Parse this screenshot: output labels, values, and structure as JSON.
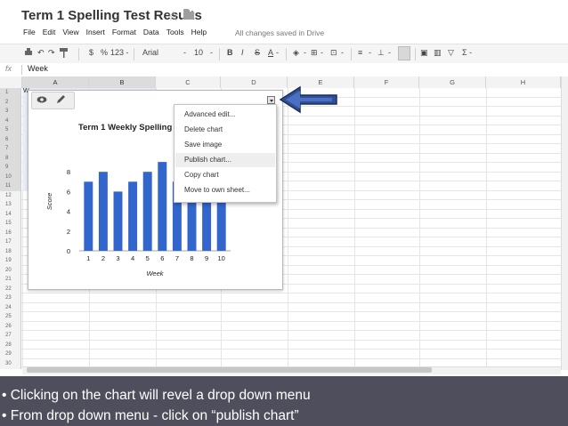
{
  "title_bar": {
    "title": "Term 1 Spelling Test Results",
    "star_icon": "star-icon",
    "folder_icon": "folder-icon"
  },
  "menu": {
    "items": [
      "File",
      "Edit",
      "View",
      "Insert",
      "Format",
      "Data",
      "Tools",
      "Help"
    ],
    "status": "All changes saved in Drive"
  },
  "toolbar": {
    "currency": "$",
    "percent": "%",
    "number_format": "123 -",
    "font": "Arial",
    "font_size": "10",
    "bold": "B",
    "italic": "I",
    "strike": "S",
    "text_color": "A",
    "function": "Σ -"
  },
  "formula_bar": {
    "fx": "fx",
    "value": "Week"
  },
  "sheet": {
    "columns": [
      "A",
      "B",
      "C",
      "D",
      "E",
      "F",
      "G",
      "H"
    ],
    "selected_columns": [
      "A",
      "B"
    ],
    "rows": [
      "1",
      "2",
      "3",
      "4",
      "5",
      "6",
      "7",
      "8",
      "9",
      "10",
      "11",
      "12",
      "13",
      "14",
      "15",
      "16",
      "17",
      "18",
      "19",
      "20",
      "21",
      "22",
      "23",
      "24",
      "25",
      "26",
      "27",
      "28",
      "29",
      "30",
      "31"
    ],
    "selected_rows_count": 11,
    "cell_a1": "W"
  },
  "chart": {
    "dropdown_icon": "chevron-down-icon",
    "toolbar_icons": [
      "eye-icon",
      "pencil-icon"
    ],
    "title_visible": "Term 1 Weekly Spelling",
    "x_ticks": [
      "1",
      "2",
      "3",
      "4",
      "5",
      "6",
      "7",
      "8",
      "9",
      "10"
    ],
    "y_ticks": [
      "0",
      "2",
      "4",
      "6",
      "8"
    ],
    "ylabel": "Score",
    "xlabel": "Week",
    "bar_color": "#3366cc"
  },
  "chart_data": {
    "type": "bar",
    "title": "Term 1 Weekly Spelling",
    "xlabel": "Week",
    "ylabel": "Score",
    "categories": [
      "1",
      "2",
      "3",
      "4",
      "5",
      "6",
      "7",
      "8",
      "9",
      "10"
    ],
    "values": [
      7,
      8,
      6,
      7,
      8,
      9,
      7,
      8,
      8,
      8
    ],
    "ylim": [
      0,
      10
    ],
    "grid": false
  },
  "context_menu": {
    "items": [
      "Advanced edit...",
      "Delete chart",
      "Save image",
      "Publish chart...",
      "Copy chart",
      "Move to own sheet..."
    ],
    "highlighted_index": 3
  },
  "annotation": {
    "arrow_color": "#2f4f9a"
  },
  "caption": {
    "line1": "• Clicking on the chart will revel a drop down menu",
    "line2": "• From drop down menu - click on “publish chart”"
  }
}
